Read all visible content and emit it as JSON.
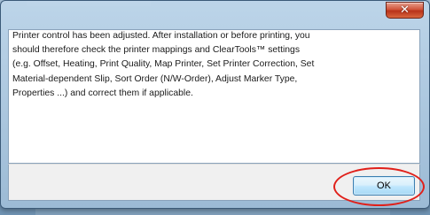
{
  "dialog": {
    "close_icon": "close-icon",
    "close_glyph": "✕",
    "message_lines": [
      "Printer control has been adjusted. After installation or before printing, you",
      "should therefore check the printer mappings and ClearTools™ settings",
      "(e.g. Offset, Heating, Print Quality, Map Printer, Set Printer Correction, Set",
      "Material-dependent Slip, Sort Order (N/W-Order), Adjust Marker Type,",
      "Properties ...) and correct them if applicable."
    ],
    "ok_label": "OK"
  },
  "colors": {
    "highlight": "#e0201a",
    "close_button": "#c8462b",
    "ok_button_border": "#3c7fb1"
  }
}
